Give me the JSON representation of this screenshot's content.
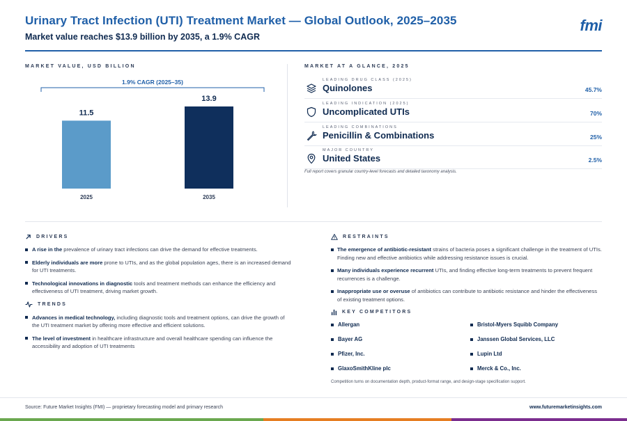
{
  "header": {
    "title": "Urinary Tract Infection (UTI) Treatment Market — Global Outlook, 2025–2035",
    "subtitle": "Market value reaches $13.9 billion by 2035, a 1.9% CAGR",
    "logo": "fmi"
  },
  "chart_section": {
    "label": "MARKET VALUE, USD BILLION"
  },
  "chart_data": {
    "type": "bar",
    "categories": [
      "2025",
      "2035"
    ],
    "values": [
      11.5,
      13.9
    ],
    "title": "",
    "xlabel": "",
    "ylabel": "",
    "ylim": [
      0,
      13.9
    ],
    "annotation": "1.9% CAGR (2025–35)",
    "bar_colors": [
      "#5b9bc9",
      "#0f2f5c"
    ]
  },
  "glance": {
    "label": "MARKET AT A GLANCE, 2025",
    "items": [
      {
        "eyebrow": "LEADING DRUG CLASS (2025)",
        "value": "Quinolones",
        "metric": "45.7%",
        "icon": "layers-icon"
      },
      {
        "eyebrow": "LEADING INDICATION (2025)",
        "value": "Uncomplicated UTIs",
        "metric": "70%",
        "icon": "shield-icon"
      },
      {
        "eyebrow": "LEADING COMBINATIONS",
        "value": "Penicillin & Combinations",
        "metric": "25%",
        "icon": "wrench-icon"
      },
      {
        "eyebrow": "MAJOR COUNTRY",
        "value": "United States",
        "metric": "2.5%",
        "icon": "map-pin-icon"
      }
    ],
    "note": "Full report covers granular country-level forecasts and detailed taxonomy analysis."
  },
  "drivers": {
    "label": "DRIVERS",
    "items": [
      {
        "bold": "A rise in the",
        "rest": " prevalence of urinary tract infections can drive the demand for effective treatments."
      },
      {
        "bold": "Elderly individuals are more",
        "rest": " prone to UTIs, and as the global population ages, there is an increased demand for UTI treatments."
      },
      {
        "bold": "Technological innovations in diagnostic",
        "rest": " tools and treatment methods can enhance the efficiency and effectiveness of UTI treatment, driving market growth."
      }
    ]
  },
  "trends": {
    "label": "TRENDS",
    "items": [
      {
        "bold": "Advances in medical technology,",
        "rest": " including diagnostic tools and treatment options, can drive the growth of the UTI treatment market by offering more effective and efficient solutions."
      },
      {
        "bold": "The level of investment",
        "rest": " in healthcare infrastructure and overall healthcare spending can influence the accessibility and adoption of UTI treatments"
      }
    ]
  },
  "restraints": {
    "label": "RESTRAINTS",
    "items": [
      {
        "bold": "The emergence of antibiotic-resistant",
        "rest": " strains of bacteria poses a significant challenge in the treatment of UTIs. Finding new and effective antibiotics while addressing resistance issues is crucial."
      },
      {
        "bold": "Many individuals experience recurrent",
        "rest": " UTIs, and finding effective long-term treatments to prevent frequent recurrences is a challenge."
      },
      {
        "bold": "Inappropriate use or overuse",
        "rest": " of antibiotics can contribute to antibiotic resistance and hinder the effectiveness of existing treatment options."
      }
    ]
  },
  "competitors": {
    "label": "KEY COMPETITORS",
    "left": [
      "Allergan",
      "Bayer AG",
      "Pfizer, Inc.",
      "GlaxoSmithKline plc"
    ],
    "right": [
      "Bristol-Myers Squibb Company",
      "Janssen Global Services, LLC",
      "Lupin Ltd",
      "Merck & Co., Inc."
    ],
    "note": "Competition turns on documentation depth, product-format range, and design-stage specification support."
  },
  "footer": {
    "source": "Source: Future Market Insights (FMI) — proprietary forecasting model and primary research",
    "url": "www.futuremarketinsights.com"
  },
  "colors": {
    "accent": "#1f5fa8",
    "navy": "#0f2a50",
    "strip": [
      "#6aa84f",
      "#e67e22",
      "#7b2d8e"
    ]
  }
}
